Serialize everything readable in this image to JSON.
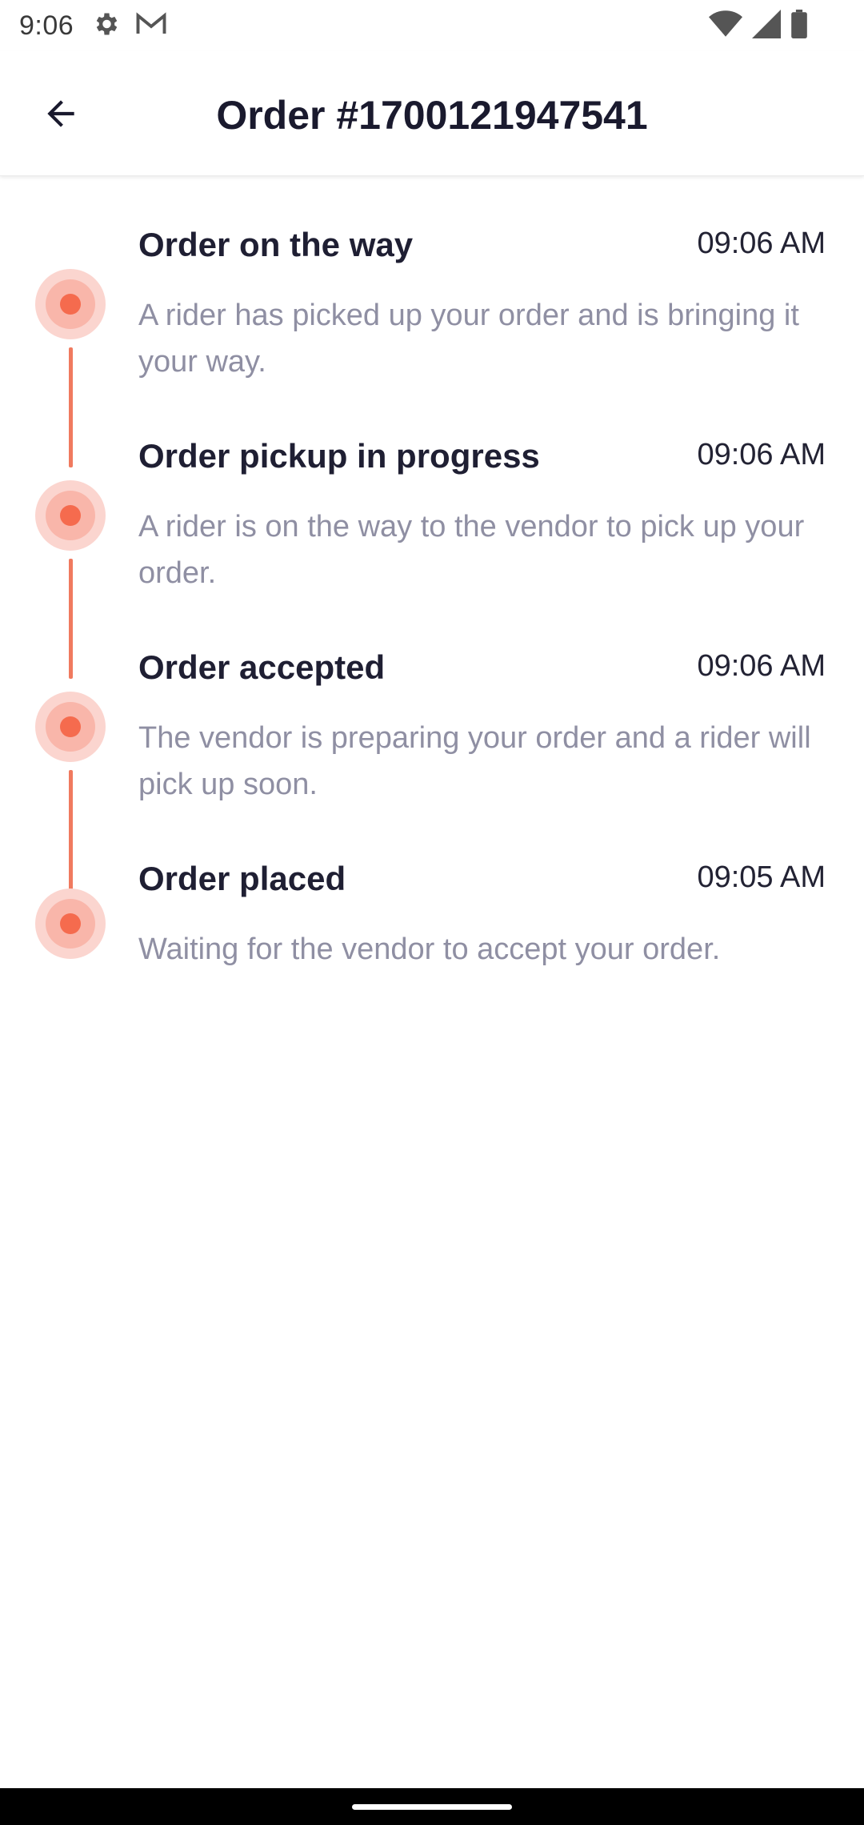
{
  "status_bar": {
    "time": "9:06",
    "icons": [
      "gear-icon",
      "gmail-icon",
      "wifi-icon",
      "signal-icon",
      "battery-icon"
    ]
  },
  "header": {
    "title": "Order #1700121947541",
    "back_icon": "arrow-left-icon"
  },
  "colors": {
    "accent": "#f56b4e",
    "connector": "#f07a5f",
    "title_text": "#1f1f33",
    "desc_text": "#8f8fa3"
  },
  "events": [
    {
      "title": "Order on the way",
      "time": "09:06 AM",
      "description": "A rider has picked up your order and is bringing it your way."
    },
    {
      "title": "Order pickup in progress",
      "time": "09:06 AM",
      "description": "A rider is on the way to the vendor to pick up your order."
    },
    {
      "title": "Order accepted",
      "time": "09:06 AM",
      "description": "The vendor is preparing your order and a rider will pick up soon."
    },
    {
      "title": "Order placed",
      "time": "09:05 AM",
      "description": "Waiting for the vendor to accept your order."
    }
  ]
}
